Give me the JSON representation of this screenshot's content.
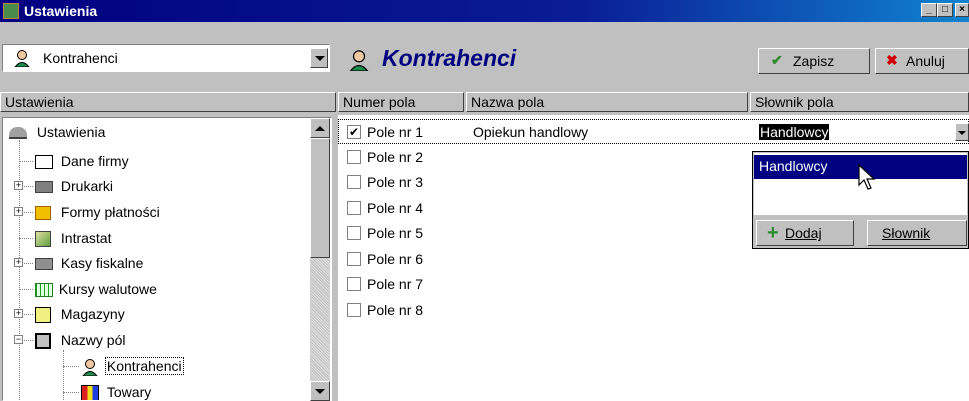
{
  "window": {
    "title": "Ustawienia",
    "minimize": "_",
    "maximize": "□",
    "close": "×"
  },
  "left": {
    "combo_value": "Kontrahenci",
    "header": "Ustawienia",
    "tree": [
      {
        "label": "Ustawienia"
      },
      {
        "label": "Dane firmy"
      },
      {
        "label": "Drukarki"
      },
      {
        "label": "Formy płatności"
      },
      {
        "label": "Intrastat"
      },
      {
        "label": "Kasy fiskalne"
      },
      {
        "label": "Kursy walutowe"
      },
      {
        "label": "Magazyny"
      },
      {
        "label": "Nazwy pól"
      },
      {
        "label": "Kontrahenci"
      },
      {
        "label": "Towary"
      }
    ],
    "expanders": {
      "plus": "+",
      "minus": "−"
    }
  },
  "right": {
    "title": "Kontrahenci",
    "save_label": "Zapisz",
    "save_icon": "✔",
    "cancel_label": "Anuluj",
    "cancel_icon": "✖",
    "columns": [
      "Numer pola",
      "Nazwa pola",
      "Słownik pola"
    ],
    "rows": [
      {
        "field": "Pole nr 1",
        "name": "Opiekun handlowy",
        "dict": "Handlowcy",
        "checked": true,
        "check_mark": "✔"
      },
      {
        "field": "Pole nr 2",
        "name": "",
        "dict": "",
        "checked": false
      },
      {
        "field": "Pole nr 3",
        "name": "",
        "dict": "",
        "checked": false
      },
      {
        "field": "Pole nr 4",
        "name": "",
        "dict": "",
        "checked": false
      },
      {
        "field": "Pole nr 5",
        "name": "",
        "dict": "",
        "checked": false
      },
      {
        "field": "Pole nr 6",
        "name": "",
        "dict": "",
        "checked": false
      },
      {
        "field": "Pole nr 7",
        "name": "",
        "dict": "",
        "checked": false
      },
      {
        "field": "Pole nr 8",
        "name": "",
        "dict": "",
        "checked": false
      }
    ],
    "dropdown": {
      "items": [
        "Handlowcy"
      ],
      "add_label": "Dodaj",
      "add_icon": "+",
      "dict_label": "Słownik"
    }
  },
  "colors": {
    "titlebar": "#000080",
    "selection": "#000080",
    "face": "#c0c0c0",
    "accent_green": "#2e8b2e",
    "accent_red": "#d00000"
  }
}
